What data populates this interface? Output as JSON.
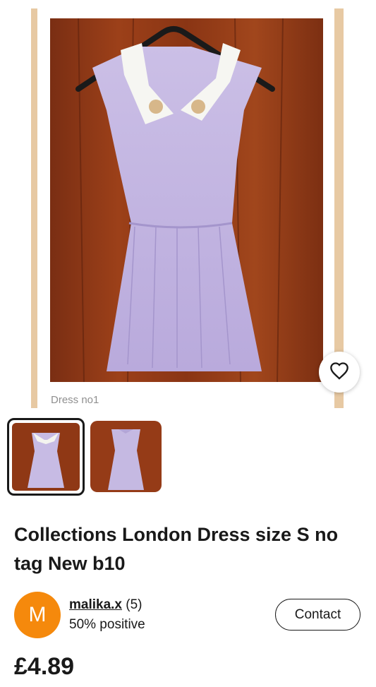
{
  "listing": {
    "image_caption": "Dress no1",
    "title": "Collections London Dress size S no tag New b10",
    "price": "£4.89",
    "selected_image": 1,
    "image_count": 2
  },
  "seller": {
    "avatar_letter": "M",
    "username": "malika.x",
    "feedback_count": "(5)",
    "feedback_text": "50% positive",
    "avatar_color": "#f5890c"
  },
  "actions": {
    "contact_label": "Contact"
  },
  "icons": {
    "favorite": "heart-icon"
  }
}
